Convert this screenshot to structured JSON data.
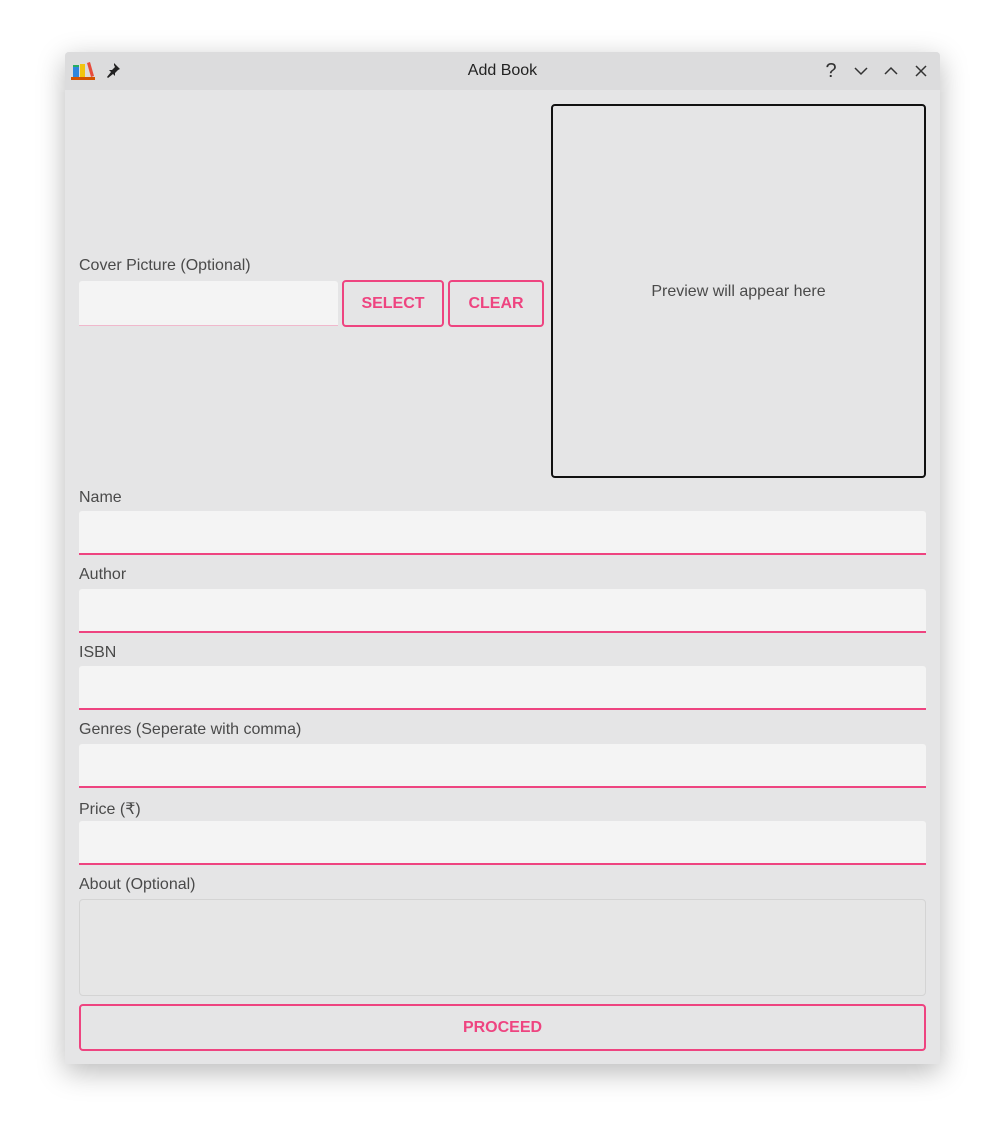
{
  "window": {
    "title": "Add Book"
  },
  "titlebar_icons": {
    "app": "app-icon",
    "pin": "pin-icon",
    "help": "?",
    "minimize": "chevron-down-icon",
    "maximize": "chevron-up-icon",
    "close": "close-icon"
  },
  "cover": {
    "label": "Cover Picture (Optional)",
    "value": "",
    "select_label": "SELECT",
    "clear_label": "CLEAR",
    "preview_text": "Preview will appear here"
  },
  "fields": {
    "name_label": "Name",
    "author_label": "Author",
    "isbn_label": "ISBN",
    "genres_label": "Genres (Seperate with comma)",
    "price_label": "Price (₹)",
    "about_label": "About (Optional)"
  },
  "actions": {
    "proceed_label": "PROCEED"
  },
  "colors": {
    "accent": "#ee4480",
    "background": "#e5e5e6",
    "field": "#f4f4f4"
  }
}
